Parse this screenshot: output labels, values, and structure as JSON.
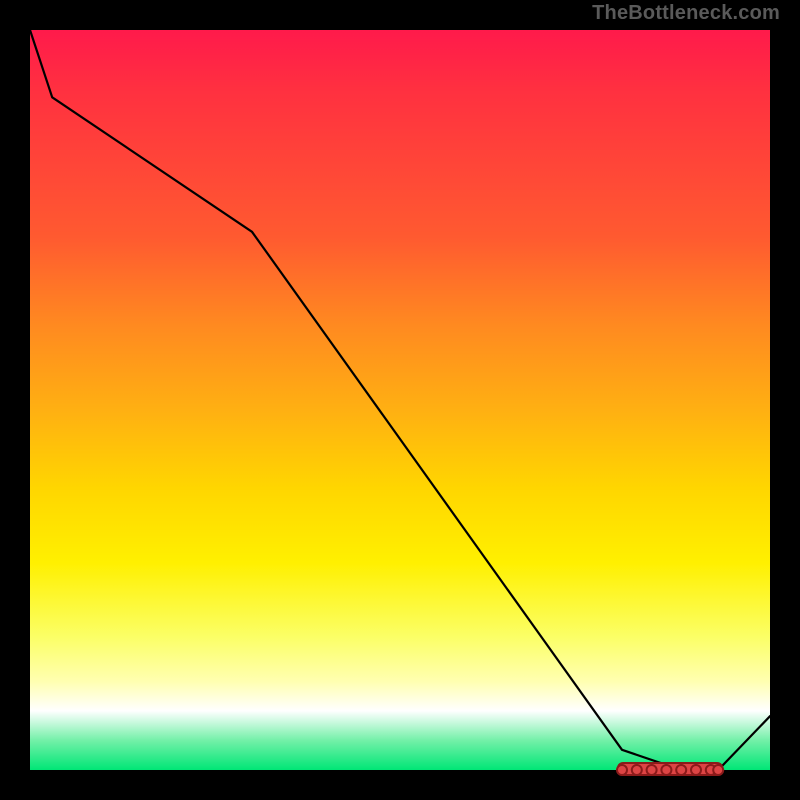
{
  "attribution": "TheBottleneck.com",
  "chart_data": {
    "type": "line",
    "title": "",
    "xlabel": "",
    "ylabel": "",
    "x": [
      0,
      3,
      30,
      80,
      88,
      93,
      100
    ],
    "y": [
      110,
      100,
      80,
      3,
      0,
      0,
      8
    ],
    "ylim": [
      0,
      110
    ],
    "xlim": [
      0,
      100
    ],
    "highlight_range_x": [
      80,
      93
    ],
    "highlight_y": 0,
    "markers_x": [
      80,
      82,
      84,
      86,
      88,
      90,
      92,
      93
    ],
    "gradient_stops": [
      {
        "pos": 0.0,
        "color": "#ff1a4b"
      },
      {
        "pos": 0.5,
        "color": "#ffb800"
      },
      {
        "pos": 0.8,
        "color": "#fff000"
      },
      {
        "pos": 0.92,
        "color": "#ffffff"
      },
      {
        "pos": 1.0,
        "color": "#00e676"
      }
    ]
  }
}
